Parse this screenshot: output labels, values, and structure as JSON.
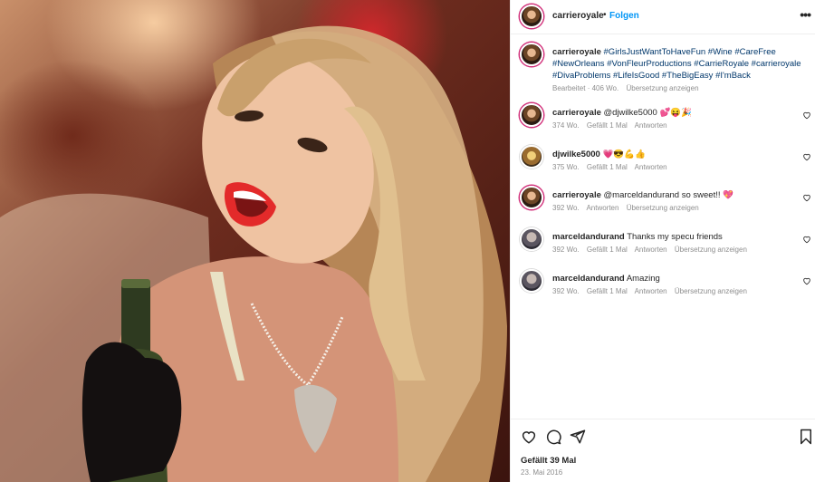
{
  "post": {
    "username": "carrieroyale",
    "separator": "•",
    "follow_label": "Folgen",
    "more_label": "•••"
  },
  "caption": {
    "username": "carrieroyale",
    "hashtags": "#GirlsJustWantToHaveFun #Wine #CareFree #NewOrleans #VonFleurProductions #CarrieRoyale #carrieroyale #DivaProblems #LifeIsGood #TheBigEasy #I'mBack",
    "edited": "Bearbeitet · 406 Wo.",
    "translate": "Übersetzung anzeigen"
  },
  "comments": [
    {
      "username": "carrieroyale",
      "text": "@djwilke5000 💕😝🎉",
      "age": "374 Wo.",
      "likes": "Gefällt 1 Mal",
      "reply": "Antworten",
      "translate": ""
    },
    {
      "username": "djwilke5000",
      "text": "💗😎💪👍",
      "age": "375 Wo.",
      "likes": "Gefällt 1 Mal",
      "reply": "Antworten",
      "translate": ""
    },
    {
      "username": "carrieroyale",
      "text": "@marceldandurand so sweet!! 💖",
      "age": "392 Wo.",
      "likes": "",
      "reply": "Antworten",
      "translate": "Übersetzung anzeigen"
    },
    {
      "username": "marceldandurand",
      "text": "Thanks my specu friends",
      "age": "392 Wo.",
      "likes": "Gefällt 1 Mal",
      "reply": "Antworten",
      "translate": "Übersetzung anzeigen"
    },
    {
      "username": "marceldandurand",
      "text": "Amazing",
      "age": "392 Wo.",
      "likes": "Gefällt 1 Mal",
      "reply": "Antworten",
      "translate": "Übersetzung anzeigen"
    }
  ],
  "footer": {
    "likes": "Gefällt 39 Mal",
    "date": "23. Mai 2016"
  },
  "icons": {
    "like": "heart-icon",
    "comment": "comment-icon",
    "share": "share-icon",
    "save": "bookmark-icon",
    "more": "more-icon"
  },
  "colors": {
    "accent": "#0095f6",
    "hashtag": "#00376b",
    "muted": "#8e8e8e",
    "text": "#262626"
  }
}
